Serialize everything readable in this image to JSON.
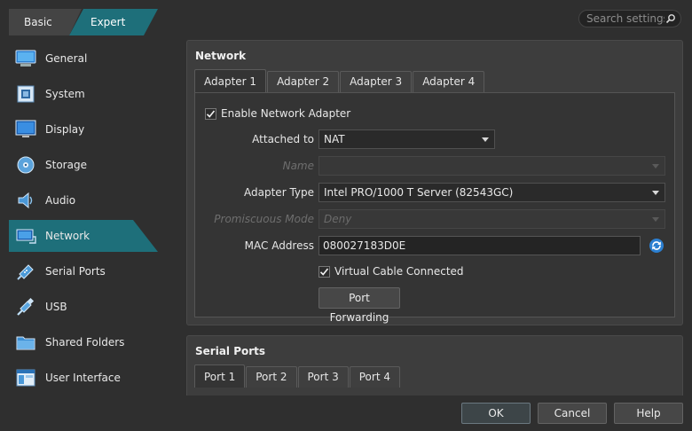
{
  "mode": {
    "basic_label": "Basic",
    "expert_label": "Expert",
    "active": "Expert"
  },
  "search": {
    "placeholder": "Search settings"
  },
  "sidebar": {
    "items": [
      {
        "label": "General",
        "icon": "general-icon"
      },
      {
        "label": "System",
        "icon": "system-icon"
      },
      {
        "label": "Display",
        "icon": "display-icon"
      },
      {
        "label": "Storage",
        "icon": "storage-icon"
      },
      {
        "label": "Audio",
        "icon": "audio-icon"
      },
      {
        "label": "Network",
        "icon": "network-icon",
        "active": true
      },
      {
        "label": "Serial Ports",
        "icon": "serial-ports-icon"
      },
      {
        "label": "USB",
        "icon": "usb-icon"
      },
      {
        "label": "Shared Folders",
        "icon": "shared-folders-icon"
      },
      {
        "label": "User Interface",
        "icon": "user-interface-icon"
      }
    ]
  },
  "network": {
    "title": "Network",
    "tabs": [
      "Adapter 1",
      "Adapter 2",
      "Adapter 3",
      "Adapter 4"
    ],
    "enable_label": "Enable Network Adapter",
    "attached_label": "Attached to",
    "attached_value": "NAT",
    "name_label": "Name",
    "name_value": "",
    "adapter_type_label": "Adapter Type",
    "adapter_type_value": "Intel PRO/1000 T Server (82543GC)",
    "promiscuous_label": "Promiscuous Mode",
    "promiscuous_value": "Deny",
    "mac_label": "MAC Address",
    "mac_value": "080027183D0E",
    "cable_label": "Virtual Cable Connected",
    "port_forwarding_label": "Port Forwarding"
  },
  "serial": {
    "title": "Serial Ports",
    "tabs": [
      "Port 1",
      "Port 2",
      "Port 3",
      "Port 4"
    ]
  },
  "buttons": {
    "ok": "OK",
    "cancel": "Cancel",
    "help": "Help"
  },
  "colors": {
    "accent": "#1e6f7a",
    "accent_light": "#2a8a96"
  }
}
